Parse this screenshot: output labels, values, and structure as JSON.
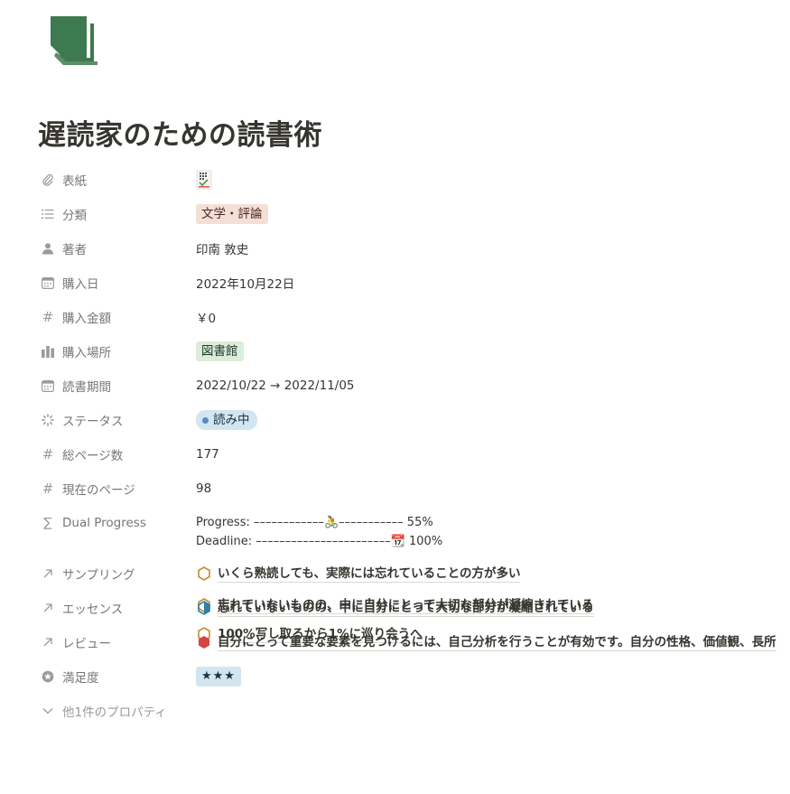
{
  "page": {
    "icon": "book-icon",
    "title": "遅読家のための読書術",
    "accent_color": "#3d7a4f"
  },
  "properties": {
    "cover": {
      "label": "表紙",
      "icon": "paperclip-icon"
    },
    "category": {
      "label": "分類",
      "icon": "list-icon",
      "value": "文学・評論",
      "color": "#f4dfd6"
    },
    "author": {
      "label": "著者",
      "icon": "person-icon",
      "value": "印南 敦史"
    },
    "purchase_date": {
      "label": "購入日",
      "icon": "calendar-icon",
      "value": "2022年10月22日"
    },
    "purchase_amount": {
      "label": "購入金額",
      "icon": "hash-icon",
      "value": "￥0"
    },
    "purchase_place": {
      "label": "購入場所",
      "icon": "multiselect-icon",
      "value": "図書館",
      "color": "#dbeddb"
    },
    "reading_period": {
      "label": "読書期間",
      "icon": "calendar-icon",
      "value": "2022/10/22 → 2022/11/05"
    },
    "status": {
      "label": "ステータス",
      "icon": "status-icon",
      "value": "読み中",
      "color": "#d3e5ef"
    },
    "total_pages": {
      "label": "総ページ数",
      "icon": "hash-icon",
      "value": "177"
    },
    "current_page": {
      "label": "現在のページ",
      "icon": "hash-icon",
      "value": "98"
    },
    "dual_progress": {
      "label": "Dual Progress",
      "icon": "sigma-icon",
      "progress_line": "Progress: ––––––––––––🚴––––––––––– 55%",
      "deadline_line": "Deadline: –––––––––––––––––––––––📆 100%",
      "progress_value": 55,
      "deadline_value": 100
    },
    "sampling": {
      "label": "サンプリング",
      "icon": "relation-arrow-icon",
      "items": [
        "いくら熟読しても、実際には忘れていることの方が多い",
        "忘れていないものの、中に自分にとって大切な部分が凝縮されている",
        "100%写し取るから1%に巡り会うへ"
      ]
    },
    "essence": {
      "label": "エッセンス",
      "icon": "relation-arrow-icon",
      "items": [
        "忘れていないものの、中に自分にとって大切な部分が凝縮されている"
      ]
    },
    "review": {
      "label": "レビュー",
      "icon": "relation-arrow-icon",
      "items": [
        "自分にとって重要な要素を見つけるには、自己分析を行うことが有効です。自分の性格、価値観、長所"
      ]
    },
    "satisfaction": {
      "label": "満足度",
      "icon": "star-circle-icon",
      "value": "★★★",
      "rating": 3
    },
    "more": {
      "label": "他1件のプロパティ",
      "icon": "chevron-down-icon"
    }
  }
}
